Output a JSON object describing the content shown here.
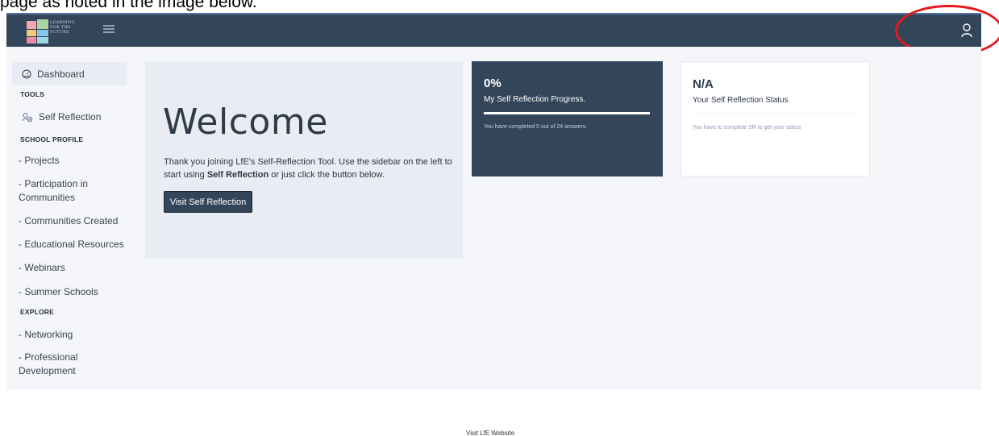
{
  "document_caption": "page as noted in the image below.",
  "brand": {
    "logo_text": "LEARNING FOR THE FUTURE"
  },
  "sidebar": {
    "dashboard_label": "Dashboard",
    "section_tools": "TOOLS",
    "self_reflection_label": "Self Reflection",
    "section_school_profile": "SCHOOL PROFILE",
    "school_profile_items": [
      "- Projects",
      "- Participation in Communities",
      "- Communities Created",
      "- Educational Resources",
      "- Webinars",
      "- Summer Schools"
    ],
    "section_explore": "EXPLORE",
    "explore_items": [
      "- Networking",
      "- Professional Development"
    ]
  },
  "welcome": {
    "title": "Welcome",
    "text_before": "Thank you joining LfE's Self-Reflection Tool. Use the sidebar on the left to start using ",
    "text_bold": "Self Reflection",
    "text_after": " or just click the button below.",
    "button_label": "Visit Self Reflection"
  },
  "progress_card": {
    "value": "0%",
    "label": "My Self Reflection Progress.",
    "progress_fraction": 0,
    "note": "You have completed 0 out of 24 answers."
  },
  "status_card": {
    "value": "N/A",
    "label": "Your Self Reflection Status",
    "note": "You have to complete SR to get your status"
  },
  "footer": {
    "website_link": "Visit LfE Website"
  },
  "colors": {
    "topbar": "#334559",
    "accent_red": "#e8171b",
    "panel_bg": "#e9edf3",
    "content_bg": "#f4f6fa"
  },
  "icons": {
    "dashboard": "dashboard-gauge-icon",
    "self_reflection": "people-icon",
    "menu": "hamburger-menu-icon",
    "user": "user-icon"
  }
}
